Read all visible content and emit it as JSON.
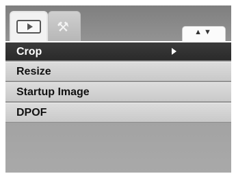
{
  "tabs": [
    {
      "name": "playback",
      "icon": "play-icon",
      "active": true
    },
    {
      "name": "setup",
      "icon": "tools-icon",
      "active": false
    }
  ],
  "nav": {
    "arrows": "▲▼"
  },
  "menu": {
    "items": [
      {
        "label": "Crop",
        "selected": true,
        "has_submenu": true
      },
      {
        "label": "Resize",
        "selected": false,
        "has_submenu": false
      },
      {
        "label": "Startup Image",
        "selected": false,
        "has_submenu": false
      },
      {
        "label": "DPOF",
        "selected": false,
        "has_submenu": false
      }
    ]
  },
  "colors": {
    "selected_row": "#2f2f2f",
    "normal_row": "#d2d2d2",
    "background": "#9a9a9a"
  }
}
